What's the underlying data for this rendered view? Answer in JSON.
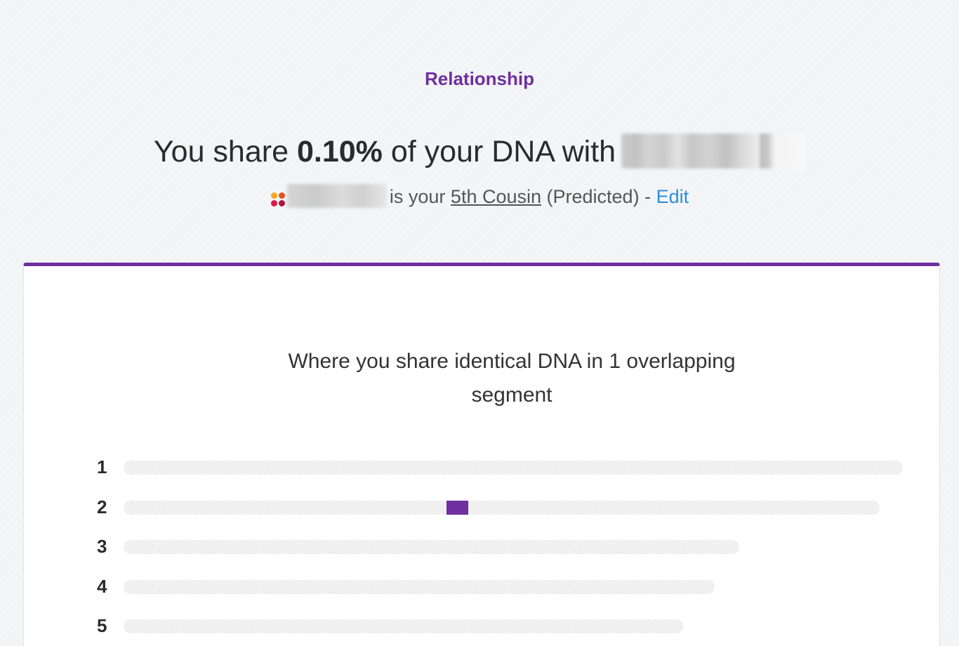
{
  "header": {
    "eyebrow": "Relationship",
    "headline_prefix": "You share ",
    "headline_percent": "0.10%",
    "headline_suffix": " of your DNA with",
    "subline_middle": "is your ",
    "relationship": "5th Cousin",
    "subline_suffix": " (Predicted) - ",
    "edit_label": "Edit"
  },
  "colors": {
    "accent": "#6f2f9f",
    "link": "#2b8fd6"
  },
  "card": {
    "title": "Where you share identical DNA in 1 overlapping segment"
  },
  "chromosomes": [
    {
      "label": "1",
      "length": 1.0,
      "segments": []
    },
    {
      "label": "2",
      "length": 0.97,
      "segments": [
        {
          "start": 0.427,
          "end": 0.456
        }
      ]
    },
    {
      "label": "3",
      "length": 0.79,
      "segments": []
    },
    {
      "label": "4",
      "length": 0.759,
      "segments": []
    },
    {
      "label": "5",
      "length": 0.719,
      "segments": []
    }
  ]
}
